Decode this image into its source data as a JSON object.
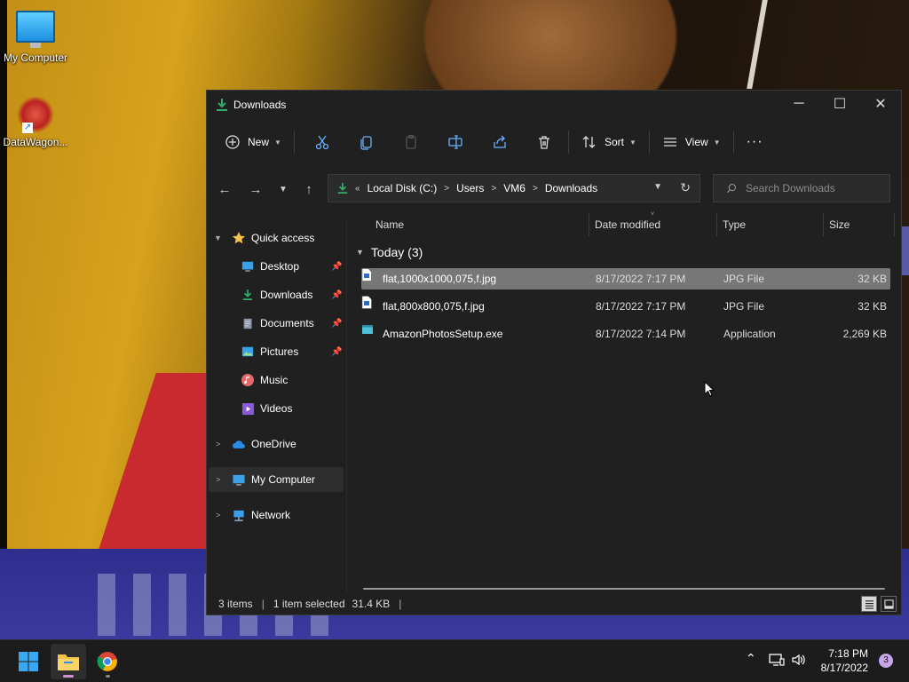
{
  "desktop": {
    "icons": [
      {
        "label": "My Computer",
        "icon": "monitor-icon"
      },
      {
        "label": "DataWagon...",
        "icon": "datawagon-icon"
      }
    ]
  },
  "window": {
    "title": "Downloads",
    "controls": {
      "minimize": "─",
      "maximize": "☐",
      "close": "✕"
    }
  },
  "command_bar": {
    "new_label": "New",
    "sort_label": "Sort",
    "view_label": "View",
    "more": "···"
  },
  "navigation": {
    "address_prefix": "«",
    "breadcrumbs": [
      "Local Disk (C:)",
      "Users",
      "VM6",
      "Downloads"
    ],
    "search_placeholder": "Search Downloads"
  },
  "sidebar": {
    "quick_access": "Quick access",
    "pinned": [
      {
        "label": "Desktop",
        "pinned": true
      },
      {
        "label": "Downloads",
        "pinned": true
      },
      {
        "label": "Documents",
        "pinned": true
      },
      {
        "label": "Pictures",
        "pinned": true
      },
      {
        "label": "Music",
        "pinned": false
      },
      {
        "label": "Videos",
        "pinned": false
      }
    ],
    "onedrive": "OneDrive",
    "my_computer": "My Computer",
    "network": "Network"
  },
  "file_list": {
    "columns": [
      "Name",
      "Date modified",
      "Type",
      "Size"
    ],
    "group": "Today (3)",
    "rows": [
      {
        "name": "flat,1000x1000,075,f.jpg",
        "date": "8/17/2022 7:17 PM",
        "type": "JPG File",
        "size": "32 KB",
        "selected": true
      },
      {
        "name": "flat,800x800,075,f.jpg",
        "date": "8/17/2022 7:17 PM",
        "type": "JPG File",
        "size": "32 KB",
        "selected": false
      },
      {
        "name": "AmazonPhotosSetup.exe",
        "date": "8/17/2022 7:14 PM",
        "type": "Application",
        "size": "2,269 KB",
        "selected": false
      }
    ]
  },
  "status_bar": {
    "items": "3 items",
    "selected": "1 item selected",
    "selected_size": "31.4 KB"
  },
  "taskbar": {
    "time": "7:18 PM",
    "date": "8/17/2022",
    "notifications": "3"
  },
  "colors": {
    "window_bg": "#202020",
    "selection": "#777777",
    "accent_green": "#2fb06c",
    "folder_yellow": "#f4c24a",
    "taskbar_bg": "#1c1c1c"
  }
}
